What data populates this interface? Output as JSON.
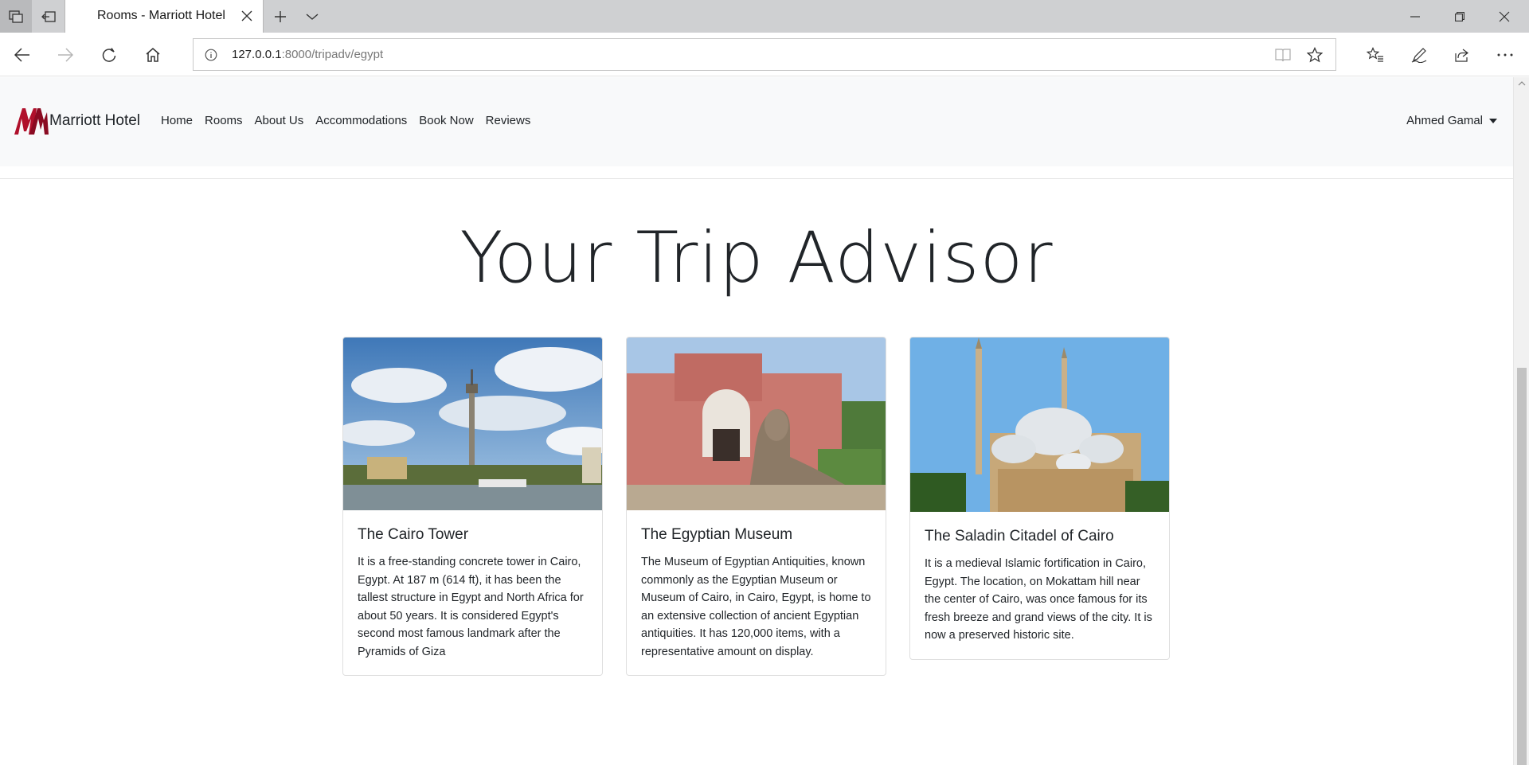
{
  "browser": {
    "tab_title": "Rooms - Marriott Hotel",
    "url_host": "127.0.0.1",
    "url_path": ":8000/tripadv/egypt"
  },
  "navbar": {
    "brand": "Marriott Hotel",
    "links": [
      "Home",
      "Rooms",
      "About Us",
      "Accommodations",
      "Book Now",
      "Reviews"
    ],
    "user": "Ahmed Gamal"
  },
  "page": {
    "heading": "Your Trip Advisor",
    "cards": [
      {
        "title": "The Cairo Tower",
        "text": "It is a free-standing concrete tower in Cairo, Egypt. At 187 m (614 ft), it has been the tallest structure in Egypt and North Africa for about 50 years. It is considered Egypt's second most famous landmark after the Pyramids of Giza"
      },
      {
        "title": "The Egyptian Museum",
        "text": "The Museum of Egyptian Antiquities, known commonly as the Egyptian Museum or Museum of Cairo, in Cairo, Egypt, is home to an extensive collection of ancient Egyptian antiquities. It has 120,000 items, with a representative amount on display."
      },
      {
        "title": "The Saladin Citadel of Cairo",
        "text": "It is a medieval Islamic fortification in Cairo, Egypt. The location, on Mokattam hill near the center of Cairo, was once famous for its fresh breeze and grand views of the city. It is now a preserved historic site."
      }
    ]
  },
  "colors": {
    "brand_red": "#b0102b",
    "navbar_bg": "#f8f9fa",
    "text": "#212529"
  }
}
